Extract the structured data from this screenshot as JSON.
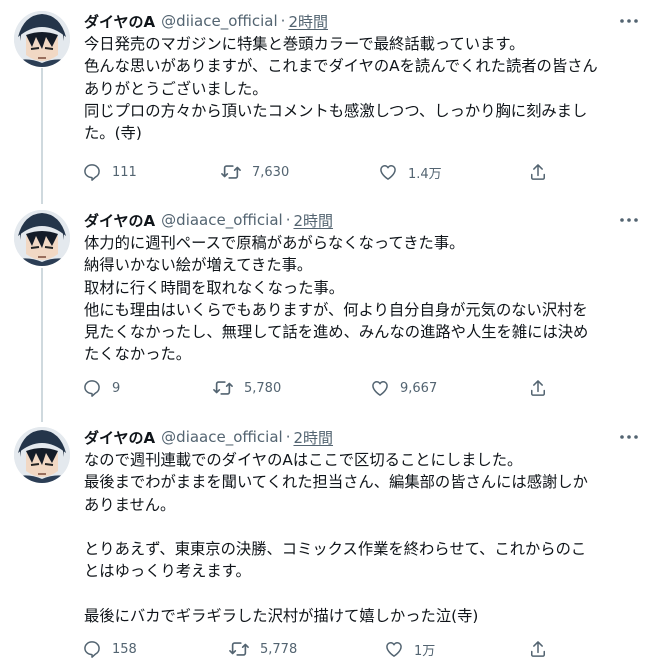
{
  "tweets": [
    {
      "author": {
        "name": "ダイヤのA",
        "handle": "@diiace_official",
        "time": "2時間"
      },
      "lines": [
        "今日発売のマガジンに特集と巻頭カラーで最終話載っています。",
        "色んな思いがありますが、これまでダイヤのAを読んでくれた読者の皆さん",
        "ありがとうございました。",
        "同じプロの方々から頂いたコメントも感激しつつ、しっかり胸に刻みまし",
        "た。(寺)"
      ],
      "stats": {
        "replies": "111",
        "retweets": "7,630",
        "likes": "1.4万"
      }
    },
    {
      "author": {
        "name": "ダイヤのA",
        "handle": "@diaace_official",
        "time": "2時間"
      },
      "lines": [
        "体力的に週刊ペースで原稿があがらなくなってきた事。",
        "納得いかない絵が増えてきた事。",
        "取材に行く時間を取れなくなった事。",
        "他にも理由はいくらでもありますが、何より自分自身が元気のない沢村を",
        "見たくなかったし、無理して話を進め、みんなの進路や人生を雑には決め",
        "たくなかった。"
      ],
      "stats": {
        "replies": "9",
        "retweets": "5,780",
        "likes": "9,667"
      }
    },
    {
      "author": {
        "name": "ダイヤのA",
        "handle": "@diaace_official",
        "time": "2時間"
      },
      "lines": [
        "なので週刊連載でのダイヤのAはここで区切ることにしました。",
        "最後までわがままを聞いてくれた担当さん、編集部の皆さんには感謝しか",
        "ありません。",
        "",
        "とりあえず、東東京の決勝、コミックス作業を終わらせて、これからのこ",
        "とはゆっくり考えます。",
        "",
        "最後にバカでギラギラした沢村が描けて嬉しかった泣(寺)"
      ],
      "stats": {
        "replies": "158",
        "retweets": "5,778",
        "likes": "1万"
      }
    }
  ],
  "icons": {
    "reply": "reply-icon",
    "retweet": "retweet-icon",
    "like": "like-icon",
    "share": "share-icon",
    "more": "more-icon",
    "avatar": "avatar-image"
  },
  "colors": {
    "text": "#0f1419",
    "secondary": "#536471",
    "rail": "#cfd9de"
  }
}
